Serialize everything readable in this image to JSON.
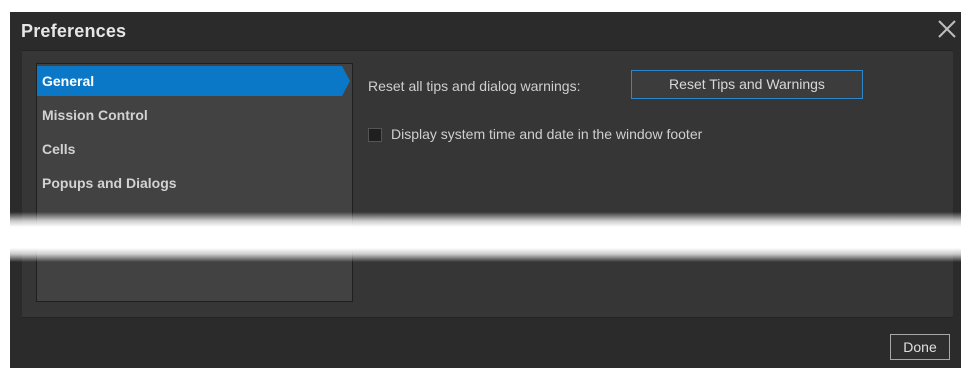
{
  "window": {
    "title": "Preferences",
    "close_icon": "close-icon"
  },
  "sidebar": {
    "items": [
      {
        "label": "General",
        "active": true
      },
      {
        "label": "Mission Control",
        "active": false
      },
      {
        "label": "Cells",
        "active": false
      },
      {
        "label": "Popups and Dialogs",
        "active": false
      }
    ]
  },
  "general": {
    "reset_label": "Reset all tips and dialog warnings:",
    "reset_button": "Reset Tips and Warnings",
    "display_time_label": "Display system time and date in the window footer",
    "display_time_checked": false
  },
  "footer": {
    "done_label": "Done"
  },
  "colors": {
    "accent": "#0a78c7",
    "dialog_bg": "#2b2b2b",
    "panel_bg": "#363636",
    "sidebar_bg": "#424242"
  }
}
